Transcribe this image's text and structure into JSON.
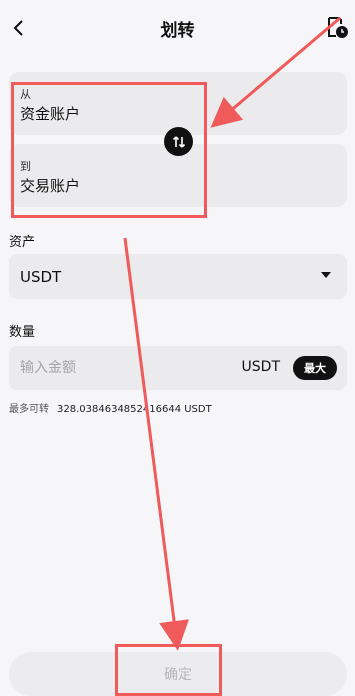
{
  "header": {
    "title": "划转"
  },
  "transfer": {
    "from_label": "从",
    "from_account": "资金账户",
    "to_label": "到",
    "to_account": "交易账户"
  },
  "asset": {
    "label": "资产",
    "selected": "USDT"
  },
  "amount": {
    "label": "数量",
    "placeholder": "输入金额",
    "unit": "USDT",
    "max_label": "最大",
    "available_label": "最多可转",
    "available_value": "328.0384634852416644 USDT"
  },
  "actions": {
    "confirm_label": "确定"
  },
  "colors": {
    "annotation": "#f05a5a",
    "dark": "#111111",
    "card": "#ebeaec"
  }
}
